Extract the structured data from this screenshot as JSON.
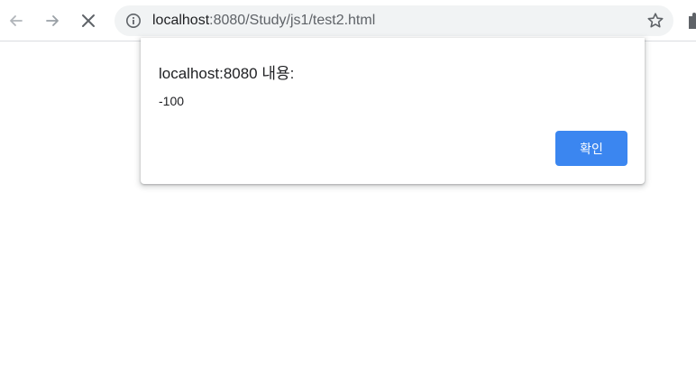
{
  "toolbar": {
    "back_icon": "arrow-left-icon",
    "forward_icon": "arrow-right-icon",
    "stop_icon": "close-icon",
    "url_host": "localhost",
    "url_rest": ":8080/Study/js1/test2.html",
    "info_icon": "info-icon",
    "bookmark_icon": "star-icon",
    "extensions_icon": "puzzle-icon"
  },
  "dialog": {
    "title": "localhost:8080 내용:",
    "message": "-100",
    "ok_label": "확인",
    "ok_color": "#3b86f0"
  },
  "colors": {
    "omnibox_bg": "#f1f3f4",
    "icon_gray": "#5f6368",
    "icon_light": "#9aa0a6"
  }
}
